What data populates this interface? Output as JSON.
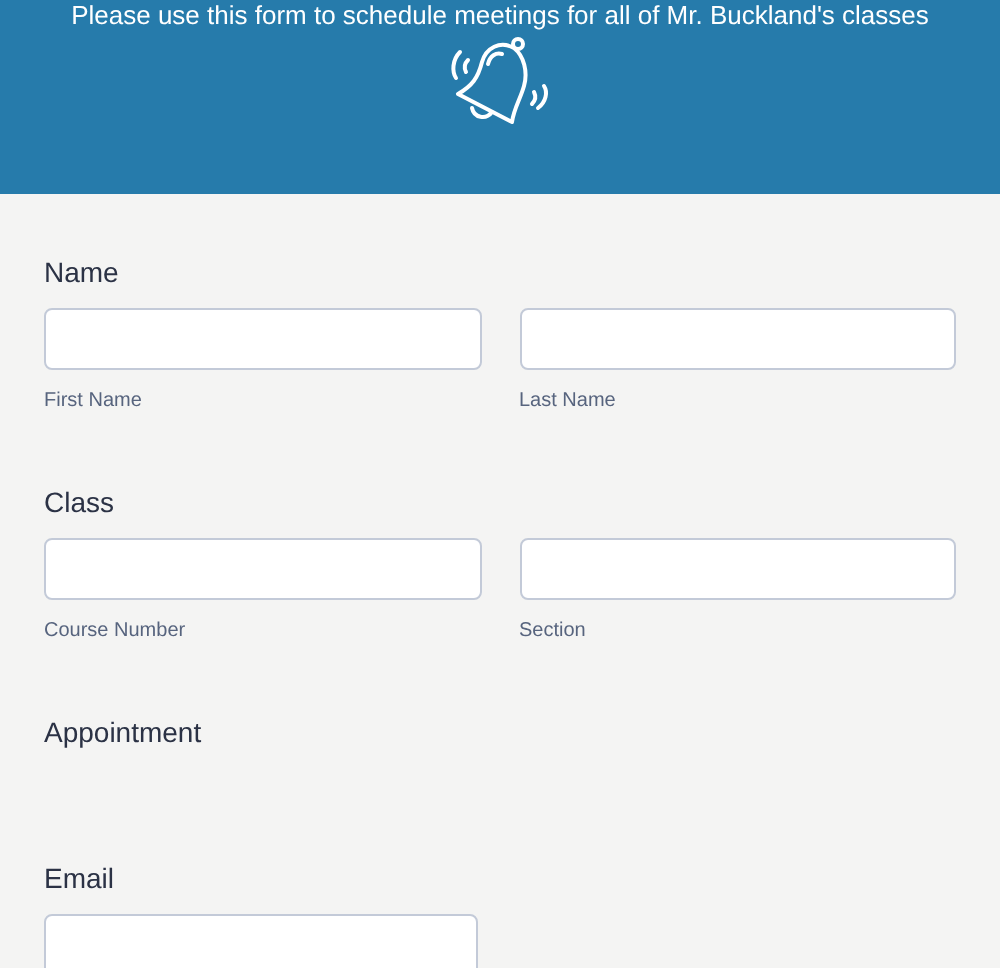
{
  "header": {
    "subtitle": "Please use this form to schedule meetings for all of Mr. Buckland's classes"
  },
  "sections": [
    {
      "kind": "pair",
      "label": "Name",
      "fields": [
        {
          "sublabel": "First Name"
        },
        {
          "sublabel": "Last Name"
        }
      ]
    },
    {
      "kind": "pair",
      "label": "Class",
      "fields": [
        {
          "sublabel": "Course Number"
        },
        {
          "sublabel": "Section"
        }
      ]
    },
    {
      "kind": "heading",
      "label": "Appointment"
    },
    {
      "kind": "single",
      "label": "Email"
    }
  ]
}
